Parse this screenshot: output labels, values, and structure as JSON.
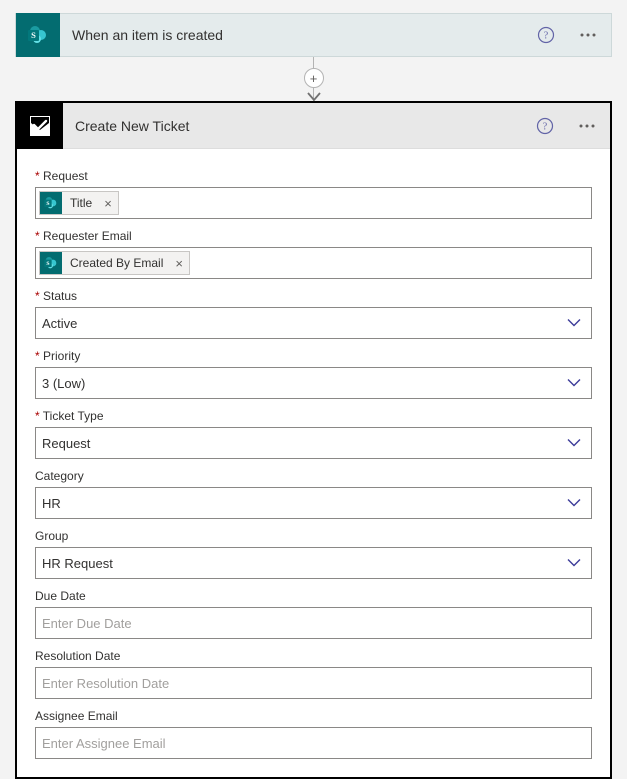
{
  "trigger": {
    "title": "When an item is created"
  },
  "action": {
    "title": "Create New Ticket"
  },
  "fields": {
    "request": {
      "label": "Request",
      "token": "Title"
    },
    "requester_email": {
      "label": "Requester Email",
      "token": "Created By Email"
    },
    "status": {
      "label": "Status",
      "value": "Active"
    },
    "priority": {
      "label": "Priority",
      "value": "3 (Low)"
    },
    "ticket_type": {
      "label": "Ticket Type",
      "value": "Request"
    },
    "category": {
      "label": "Category",
      "value": "HR"
    },
    "group": {
      "label": "Group",
      "value": "HR Request"
    },
    "due_date": {
      "label": "Due Date",
      "placeholder": "Enter Due Date"
    },
    "resolution_date": {
      "label": "Resolution Date",
      "placeholder": "Enter Resolution Date"
    },
    "assignee_email": {
      "label": "Assignee Email",
      "placeholder": "Enter Assignee Email"
    }
  }
}
